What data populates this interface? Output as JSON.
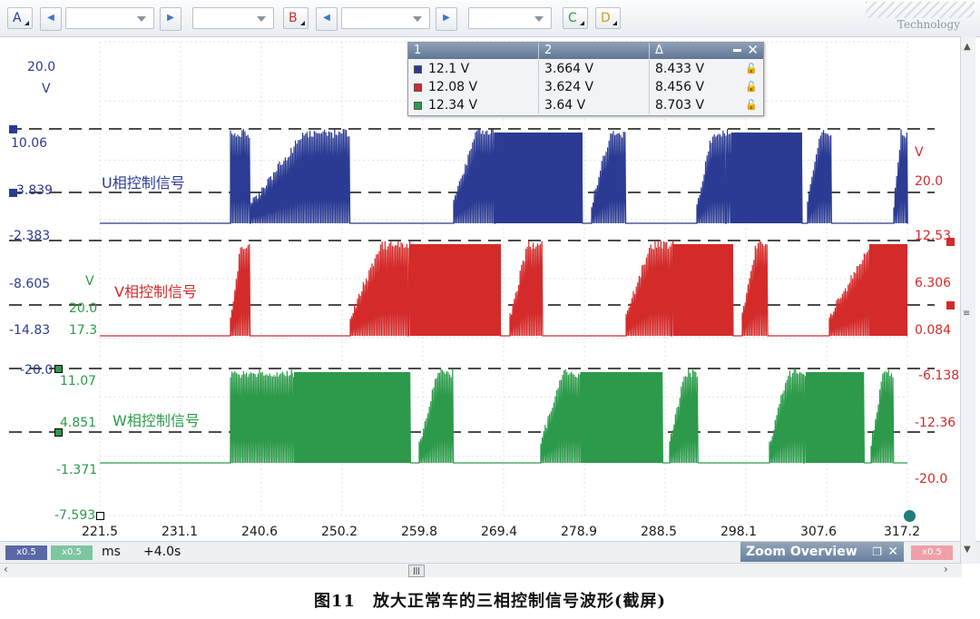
{
  "toolbar": {
    "channels": [
      {
        "name": "A",
        "color": "#2b3b93"
      },
      {
        "name": "B",
        "color": "#d42a2a"
      },
      {
        "name": "C",
        "color": "#2c9a4a"
      },
      {
        "name": "D",
        "color": "#c8a020"
      }
    ],
    "logo_text": "Technology"
  },
  "cursor_table": {
    "headers": [
      "1",
      "2",
      "Δ"
    ],
    "rows": [
      {
        "channel": "U",
        "color": "#2b3b93",
        "v1": "12.1 V",
        "v2": "3.664 V",
        "delta": "8.433 V"
      },
      {
        "channel": "V",
        "color": "#d42a2a",
        "v1": "12.08 V",
        "v2": "3.624 V",
        "delta": "8.456 V"
      },
      {
        "channel": "W",
        "color": "#2c9a4a",
        "v1": "12.34 V",
        "v2": "3.64 V",
        "delta": "8.703 V"
      }
    ]
  },
  "axes": {
    "left_blue": [
      "20.0",
      "V",
      "10.06",
      "3.839",
      "-2.383",
      "-8.605",
      "-14.83",
      "-20.0"
    ],
    "left_green": [
      "V",
      "20.0",
      "17.3",
      "11.07",
      "4.851",
      "-1.371",
      "-7.593"
    ],
    "right_red": [
      "V",
      "20.0",
      "12.53",
      "6.306",
      "0.084",
      "-6.138",
      "-12.36",
      "-20.0"
    ],
    "time_ticks": [
      "221.5",
      "231.1",
      "240.6",
      "250.2",
      "259.8",
      "269.4",
      "278.9",
      "288.5",
      "298.1",
      "307.6",
      "317.2"
    ],
    "time_unit": "ms",
    "time_offset": "+4.0s"
  },
  "labels": {
    "u": "U相控制信号",
    "v": "V相控制信号",
    "w": "W相控制信号"
  },
  "bottom": {
    "zoom_a": "x0.5",
    "zoom_c": "x0.5",
    "zoom_b": "x0.5",
    "zoom_overview": "Zoom Overview"
  },
  "caption": "图11　放大正常车的三相控制信号波形(截屏)"
}
